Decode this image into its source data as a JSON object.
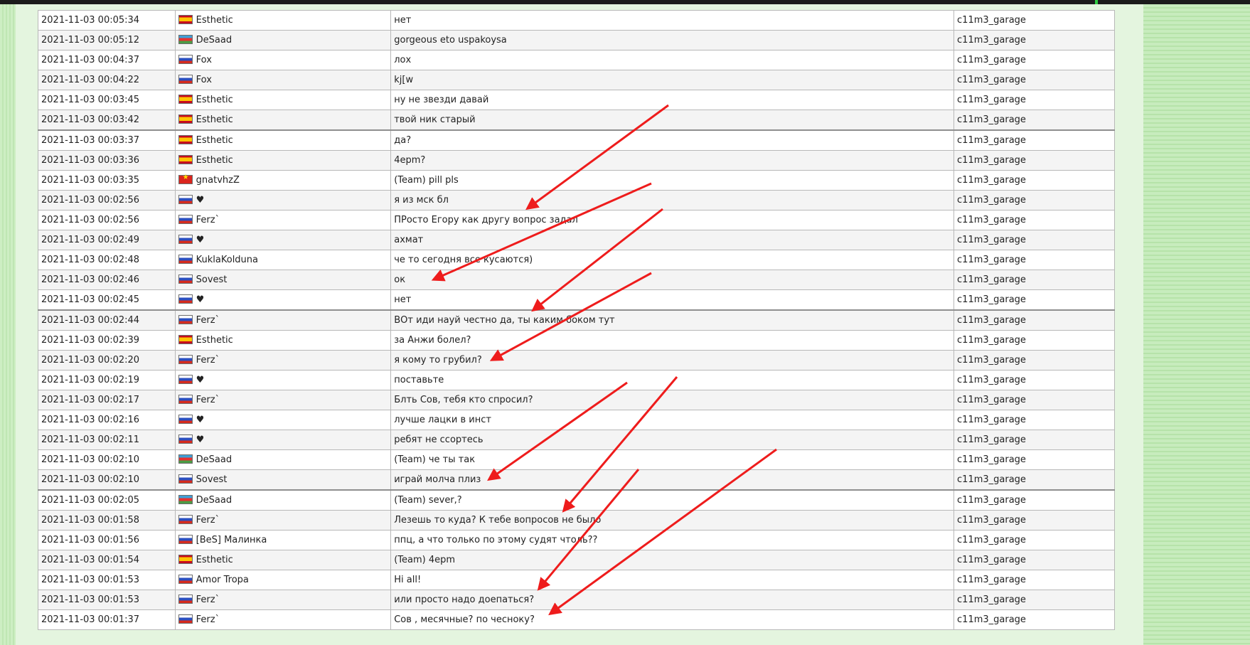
{
  "table": {
    "rows": [
      {
        "time": "2021-11-03 00:05:34",
        "player": "Esthetic",
        "flag": "spain-flag-icon",
        "message": "нет",
        "server": "c11m3_garage"
      },
      {
        "time": "2021-11-03 00:05:12",
        "player": "DeSaad",
        "flag": "azerbaijan-flag-icon",
        "message": "gorgeous eto uspakoysa",
        "server": "c11m3_garage"
      },
      {
        "time": "2021-11-03 00:04:37",
        "player": "Fox",
        "flag": "russia-flag-icon",
        "message": "лох",
        "server": "c11m3_garage"
      },
      {
        "time": "2021-11-03 00:04:22",
        "player": "Fox",
        "flag": "russia-flag-icon",
        "message": "kj[w",
        "server": "c11m3_garage"
      },
      {
        "time": "2021-11-03 00:03:45",
        "player": "Esthetic",
        "flag": "spain-flag-icon",
        "message": "ну не звезди давай",
        "server": "c11m3_garage"
      },
      {
        "time": "2021-11-03 00:03:42",
        "player": "Esthetic",
        "flag": "spain-flag-icon",
        "message": "твой ник старый",
        "server": "c11m3_garage"
      },
      {
        "time": "2021-11-03 00:03:37",
        "player": "Esthetic",
        "flag": "spain-flag-icon",
        "message": "да?",
        "server": "c11m3_garage"
      },
      {
        "time": "2021-11-03 00:03:36",
        "player": "Esthetic",
        "flag": "spain-flag-icon",
        "message": "4epm?",
        "server": "c11m3_garage"
      },
      {
        "time": "2021-11-03 00:03:35",
        "player": "gnatvhzZ",
        "flag": "vietnam-flag-icon",
        "message": "(Team) pill pls",
        "server": "c11m3_garage"
      },
      {
        "time": "2021-11-03 00:02:56",
        "player": "♥",
        "flag": "russia-flag-icon",
        "message": "я из мск бл",
        "server": "c11m3_garage"
      },
      {
        "time": "2021-11-03 00:02:56",
        "player": "Ferz`",
        "flag": "russia-flag-icon",
        "message": "ПРосто Егору как другу вопрос задал",
        "server": "c11m3_garage"
      },
      {
        "time": "2021-11-03 00:02:49",
        "player": "♥",
        "flag": "russia-flag-icon",
        "message": "ахмат",
        "server": "c11m3_garage"
      },
      {
        "time": "2021-11-03 00:02:48",
        "player": "KuklaKolduna",
        "flag": "russia-flag-icon",
        "message": "че то сегодня все кусаются)",
        "server": "c11m3_garage"
      },
      {
        "time": "2021-11-03 00:02:46",
        "player": "Sovest",
        "flag": "russia-flag-icon",
        "message": "ок",
        "server": "c11m3_garage"
      },
      {
        "time": "2021-11-03 00:02:45",
        "player": "♥",
        "flag": "russia-flag-icon",
        "message": "нет",
        "server": "c11m3_garage"
      },
      {
        "time": "2021-11-03 00:02:44",
        "player": "Ferz`",
        "flag": "russia-flag-icon",
        "message": "ВОт иди науй честно да, ты каким боком тут",
        "server": "c11m3_garage"
      },
      {
        "time": "2021-11-03 00:02:39",
        "player": "Esthetic",
        "flag": "spain-flag-icon",
        "message": "за Анжи болел?",
        "server": "c11m3_garage"
      },
      {
        "time": "2021-11-03 00:02:20",
        "player": "Ferz`",
        "flag": "russia-flag-icon",
        "message": "я кому то грубил?",
        "server": "c11m3_garage"
      },
      {
        "time": "2021-11-03 00:02:19",
        "player": "♥",
        "flag": "russia-flag-icon",
        "message": "поставьте",
        "server": "c11m3_garage"
      },
      {
        "time": "2021-11-03 00:02:17",
        "player": "Ferz`",
        "flag": "russia-flag-icon",
        "message": "Блть Сов, тебя кто спросил?",
        "server": "c11m3_garage"
      },
      {
        "time": "2021-11-03 00:02:16",
        "player": "♥",
        "flag": "russia-flag-icon",
        "message": "лучше лацки в инст",
        "server": "c11m3_garage"
      },
      {
        "time": "2021-11-03 00:02:11",
        "player": "♥",
        "flag": "russia-flag-icon",
        "message": "ребят не ссортесь",
        "server": "c11m3_garage"
      },
      {
        "time": "2021-11-03 00:02:10",
        "player": "DeSaad",
        "flag": "azerbaijan-flag-icon",
        "message": "(Team) че ты так",
        "server": "c11m3_garage"
      },
      {
        "time": "2021-11-03 00:02:10",
        "player": "Sovest",
        "flag": "russia-flag-icon",
        "message": "играй молча плиз",
        "server": "c11m3_garage"
      },
      {
        "time": "2021-11-03 00:02:05",
        "player": "DeSaad",
        "flag": "azerbaijan-flag-icon",
        "message": "(Team) sever,?",
        "server": "c11m3_garage"
      },
      {
        "time": "2021-11-03 00:01:58",
        "player": "Ferz`",
        "flag": "russia-flag-icon",
        "message": "Лезешь то куда? К тебе вопросов не было",
        "server": "c11m3_garage"
      },
      {
        "time": "2021-11-03 00:01:56",
        "player": "[BeS] Малинка",
        "flag": "russia-flag-icon",
        "message": "ппц, а что только по этому судят чтоль??",
        "server": "c11m3_garage"
      },
      {
        "time": "2021-11-03 00:01:54",
        "player": "Esthetic",
        "flag": "spain-flag-icon",
        "message": "(Team) 4epm",
        "server": "c11m3_garage"
      },
      {
        "time": "2021-11-03 00:01:53",
        "player": "Amor Tropa",
        "flag": "russia-flag-icon",
        "message": "Hi all!",
        "server": "c11m3_garage"
      },
      {
        "time": "2021-11-03 00:01:53",
        "player": "Ferz`",
        "flag": "russia-flag-icon",
        "message": "или просто надо доепаться?",
        "server": "c11m3_garage"
      },
      {
        "time": "2021-11-03 00:01:37",
        "player": "Ferz`",
        "flag": "russia-flag-icon",
        "message": "Сов , месячные? по чесноку?",
        "server": "c11m3_garage"
      }
    ]
  },
  "colors": {
    "annotation_arrow": "#ee1c1c"
  }
}
